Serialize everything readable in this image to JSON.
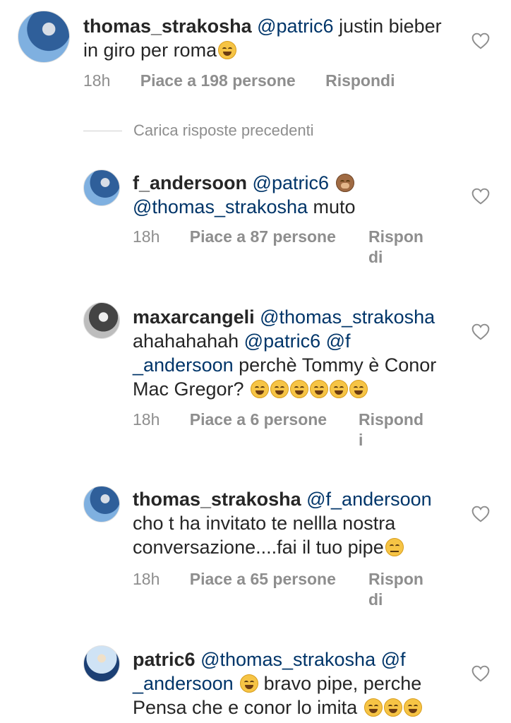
{
  "comments": [
    {
      "username": "thomas_strakosha",
      "mention": "@patric6",
      "text_1": " justin bieber",
      "text_2": "in giro per roma",
      "time": "18h",
      "likes": "Piace a 198 persone",
      "reply": "Rispondi"
    },
    {
      "username": "f_andersoon",
      "mention": "@patric6",
      "mention_2": "@thomas_strakosha",
      "text_2": " muto",
      "time": "18h",
      "likes": "Piace a 87 persone",
      "reply_1": "Rispon",
      "reply_2": "di"
    },
    {
      "username": "maxarcangeli",
      "mention": "@thomas_strakosha",
      "text_2": "ahahahahah ",
      "mention_2": "@patric6",
      "mention_3": "@f",
      "mention_4": "_andersoon",
      "text_3": " perchè Tommy è Conor",
      "text_4": "Mac Gregor?",
      "time": "18h",
      "likes": "Piace a 6 persone",
      "reply_1": "Rispond",
      "reply_2": "i"
    },
    {
      "username": "thomas_strakosha",
      "mention": "@f_andersoon",
      "text_2": "cho t ha invitato te nellla nostra",
      "text_3": "conversazione....fai il tuo pipe",
      "time": "18h",
      "likes": "Piace a 65 persone",
      "reply_1": "Rispon",
      "reply_2": "di"
    },
    {
      "username": "patric6",
      "mention": "@thomas_strakosha",
      "mention_2": "@f",
      "mention_3": "_andersoon",
      "text_2": " bravo pipe, perche",
      "text_3": "Pensa che e conor lo imita"
    }
  ],
  "load_more": "Carica risposte precedenti",
  "icons": {
    "heart": "heart-outline-icon",
    "laugh": "face-with-tears-of-joy-icon",
    "monkey": "see-no-evil-monkey-icon",
    "neutral": "neutral-face-icon"
  },
  "colors": {
    "text": "#262626",
    "mention": "#003569",
    "meta": "#8e8e8e"
  }
}
